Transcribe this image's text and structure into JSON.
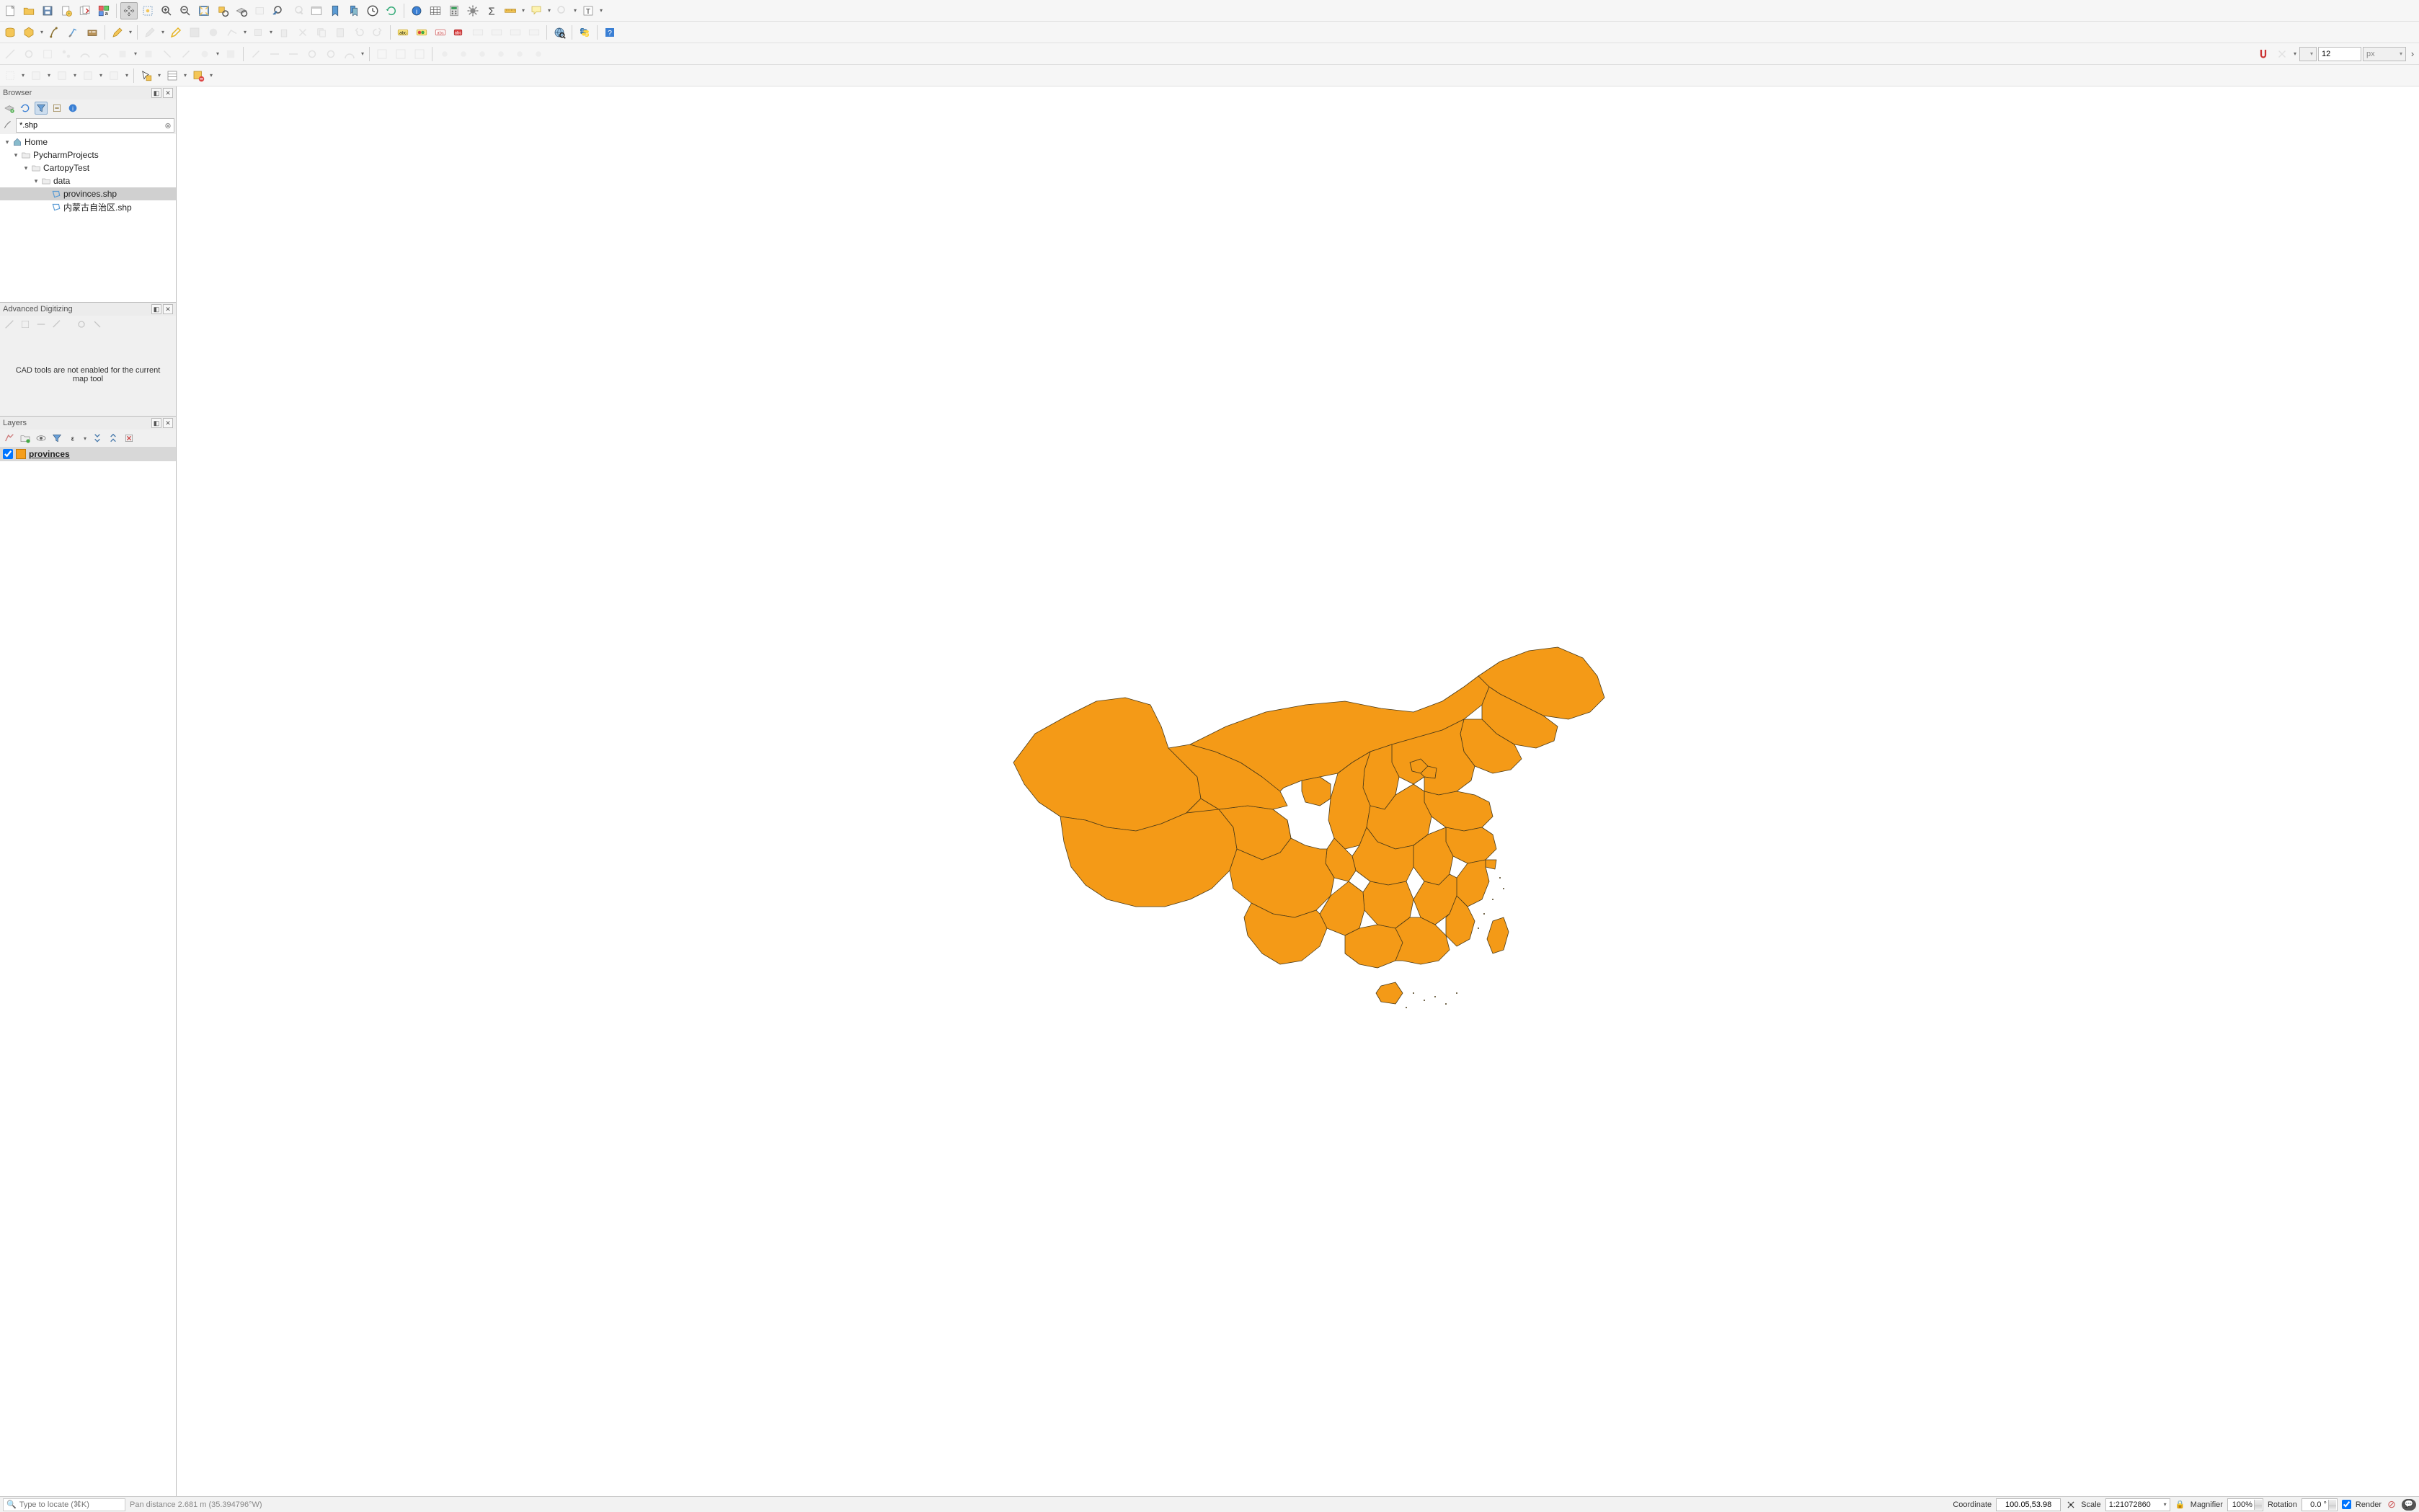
{
  "browser": {
    "title": "Browser",
    "filter_value": "*.shp",
    "tree": {
      "home": "Home",
      "pycharm": "PycharmProjects",
      "cartopy": "CartopyTest",
      "data": "data",
      "provinces": "provinces.shp",
      "neimenggu": "内蒙古自治区.shp"
    }
  },
  "adv_dig": {
    "title": "Advanced Digitizing",
    "message": "CAD tools are not enabled for the current map tool"
  },
  "layers": {
    "title": "Layers",
    "items": [
      {
        "name": "provinces",
        "checked": true,
        "color": "#f59e1b"
      }
    ]
  },
  "map": {
    "layer_fill": "#f49a17",
    "layer_stroke": "#4a3a18"
  },
  "statusbar": {
    "locator_placeholder": "Type to locate (⌘K)",
    "message": "Pan distance 2.681 m (35.394796°W)",
    "coord_label": "Coordinate",
    "coord_value": "100.05,53.98",
    "scale_label": "Scale",
    "scale_value": "1:21072860",
    "magnifier_label": "Magnifier",
    "magnifier_value": "100%",
    "rotation_label": "Rotation",
    "rotation_value": "0.0 °",
    "render_label": "Render"
  },
  "toolRow4": {
    "spinner_value": "12",
    "unit": "px"
  }
}
